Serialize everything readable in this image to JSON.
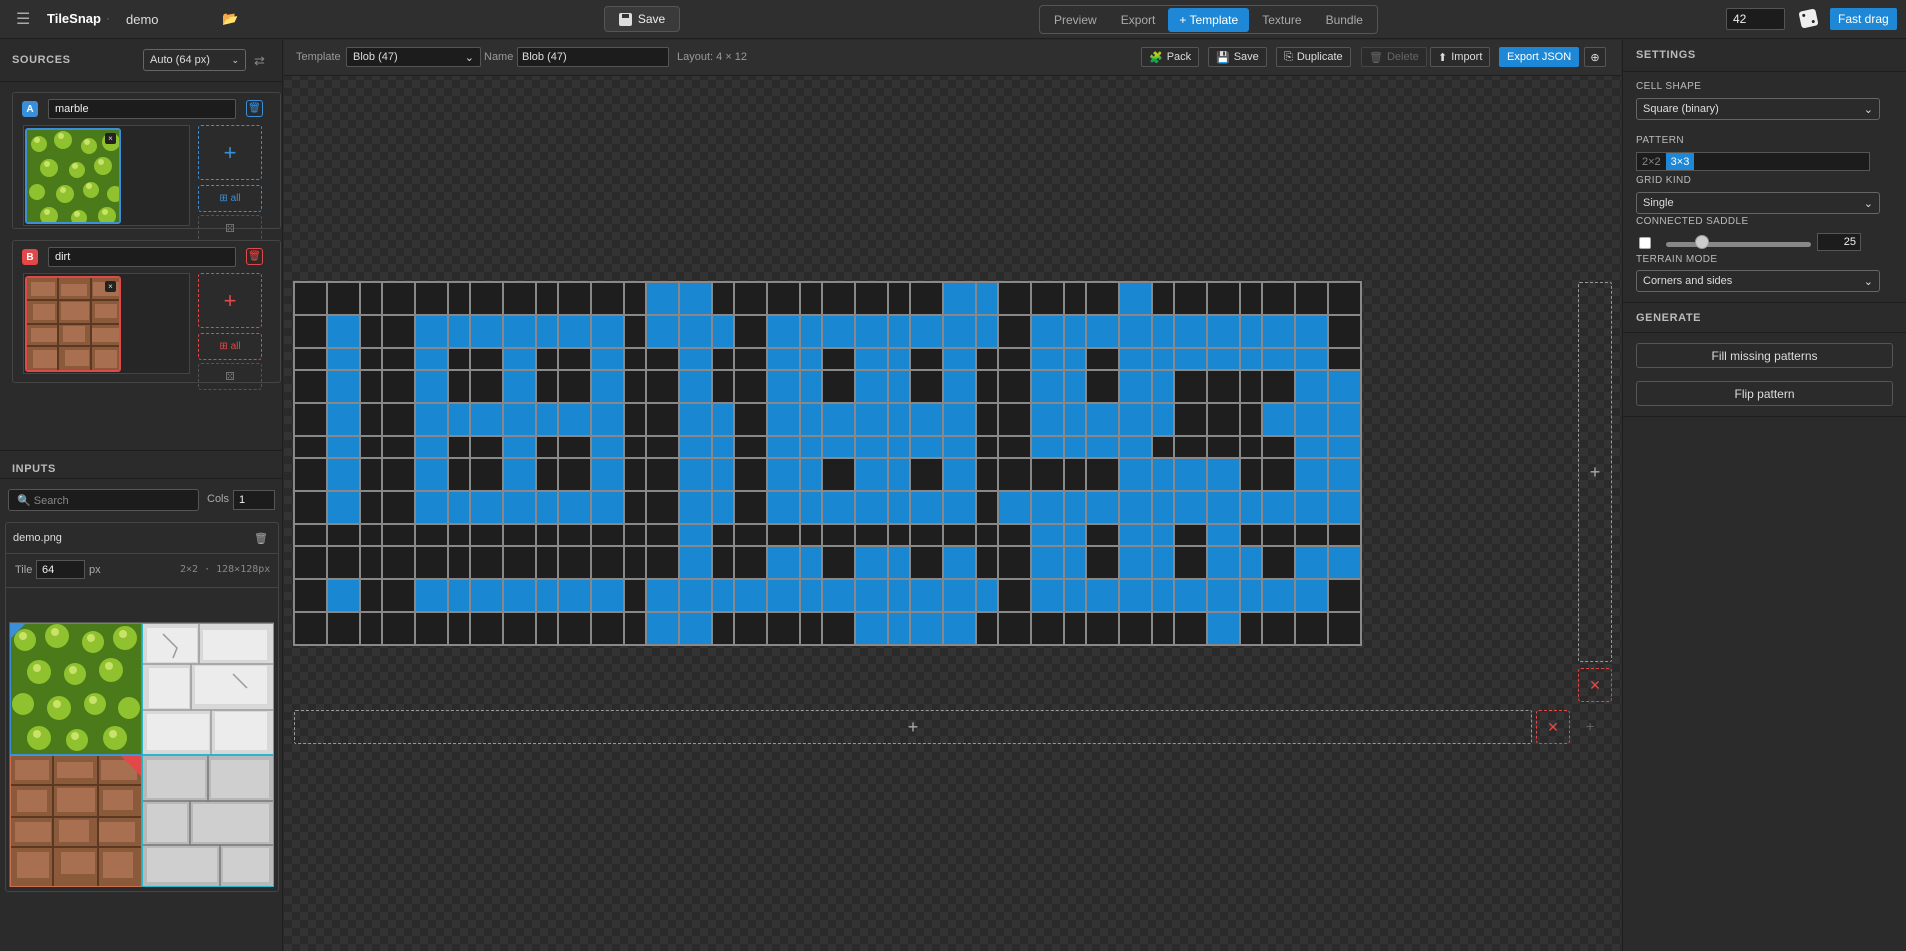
{
  "topbar": {
    "brand": "TileSnap",
    "separator": "·",
    "project_name": "demo",
    "save_label": "Save",
    "tabs": [
      "Preview",
      "Export",
      "+ Template",
      "Texture",
      "Bundle"
    ],
    "active_tab": "+ Template",
    "seed_value": "42",
    "fast_drag_label": "Fast drag"
  },
  "sources": {
    "title": "SOURCES",
    "size_select": "Auto (64 px)",
    "items": [
      {
        "badge": "A",
        "name": "marble",
        "all_label": "⊞ all",
        "accent": "#3a8fd8"
      },
      {
        "badge": "B",
        "name": "dirt",
        "all_label": "⊞ all",
        "accent": "#e24848"
      }
    ]
  },
  "inputs": {
    "title": "INPUTS",
    "search_placeholder": "Search",
    "cols_label": "Cols",
    "cols_value": "1",
    "file": {
      "name": "demo.png",
      "tile_label": "Tile",
      "tile_value": "64",
      "px_label": "px",
      "info": "2×2 · 128×128px"
    }
  },
  "template_bar": {
    "template_label": "Template",
    "template_select": "Blob (47)",
    "name_label": "Name",
    "name_value": "Blob (47)",
    "layout": "Layout: 4 × 12",
    "pack_label": "Pack",
    "save_label": "Save",
    "duplicate_label": "Duplicate",
    "delete_label": "Delete",
    "import_label": "Import",
    "export_json_label": "Export JSON"
  },
  "grid": {
    "rows": 4,
    "cols": 12,
    "cells": [
      "000010010",
      "000011010",
      "000111010",
      "000110010",
      "110111010",
      "000011011",
      "000111011",
      "011111010",
      "000011011",
      "010111011",
      "000111111",
      "000110110",
      "010010010",
      "010011010",
      "010111010",
      "010110010",
      "010011011",
      "011011011",
      "011111111",
      "010110110",
      "011011011",
      "011111110",
      "000000000",
      "011111011",
      "010010000",
      "010011000",
      "010111000",
      "010110000",
      "011011010",
      "011011000",
      "011111000",
      "010110000",
      "000111011",
      "011111011",
      "110111010",
      "011111000",
      "000010000",
      "000011000",
      "000111000",
      "000110000",
      "010111110",
      "011111000",
      "011111011",
      "010111110",
      "011011000",
      "011111000",
      "011111010",
      "011110000"
    ],
    "active_color": "#1a87d2"
  },
  "settings": {
    "title": "SETTINGS",
    "cell_shape_label": "CELL SHAPE",
    "cell_shape_value": "Square (binary)",
    "pattern_label": "PATTERN",
    "pattern_options": [
      "2×2",
      "3×3"
    ],
    "pattern_active": "3×3",
    "grid_kind_label": "GRID KIND",
    "grid_kind_value": "Single",
    "saddle_label": "CONNECTED SADDLE",
    "saddle_checked": false,
    "saddle_value": "25",
    "saddle_fraction": 0.25,
    "terrain_label": "TERRAIN MODE",
    "terrain_value": "Corners and sides"
  },
  "generate": {
    "title": "GENERATE",
    "fill_label": "Fill missing patterns",
    "flip_label": "Flip pattern"
  },
  "colors": {
    "accent": "#1e88d6",
    "danger": "#e24848"
  }
}
